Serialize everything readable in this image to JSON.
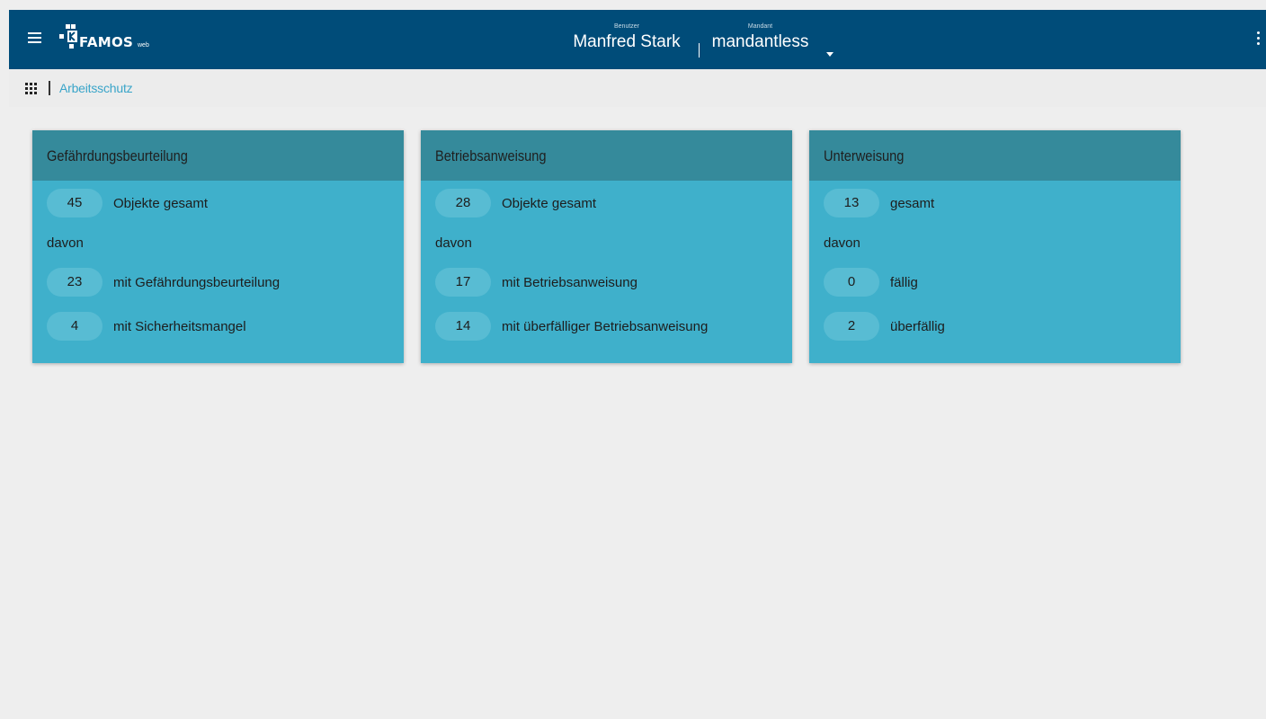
{
  "header": {
    "logo_text": "FAMOS",
    "logo_sub": "web",
    "user_caption": "Benutzer",
    "user_name": "Manfred Stark",
    "tenant_caption": "Mandant",
    "tenant_name": "mandantless",
    "icons": [
      "menu-icon",
      "dropdown-caret-icon",
      "more-vert-icon"
    ]
  },
  "breadcrumb": {
    "current": "Arbeitsschutz",
    "icons": [
      "apps-grid-icon"
    ]
  },
  "cards": [
    {
      "title": "Gefährdungsbeurteilung",
      "total": {
        "count": "45",
        "label": "Objekte gesamt"
      },
      "davon": "davon",
      "rows": [
        {
          "count": "23",
          "label": "mit Gefährdungsbeurteilung"
        },
        {
          "count": "4",
          "label": "mit Sicherheitsmangel"
        }
      ]
    },
    {
      "title": "Betriebsanweisung",
      "total": {
        "count": "28",
        "label": "Objekte gesamt"
      },
      "davon": "davon",
      "rows": [
        {
          "count": "17",
          "label": "mit Betriebsanweisung"
        },
        {
          "count": "14",
          "label": "mit überfälliger Betriebsanweisung"
        }
      ]
    },
    {
      "title": "Unterweisung",
      "total": {
        "count": "13",
        "label": "gesamt"
      },
      "davon": "davon",
      "rows": [
        {
          "count": "0",
          "label": "fällig"
        },
        {
          "count": "2",
          "label": "überfällig"
        }
      ]
    }
  ],
  "colors": {
    "topbar": "#004c79",
    "card_body": "#3fb0cb",
    "card_head": "#358a9b",
    "link": "#3aa5c9"
  }
}
